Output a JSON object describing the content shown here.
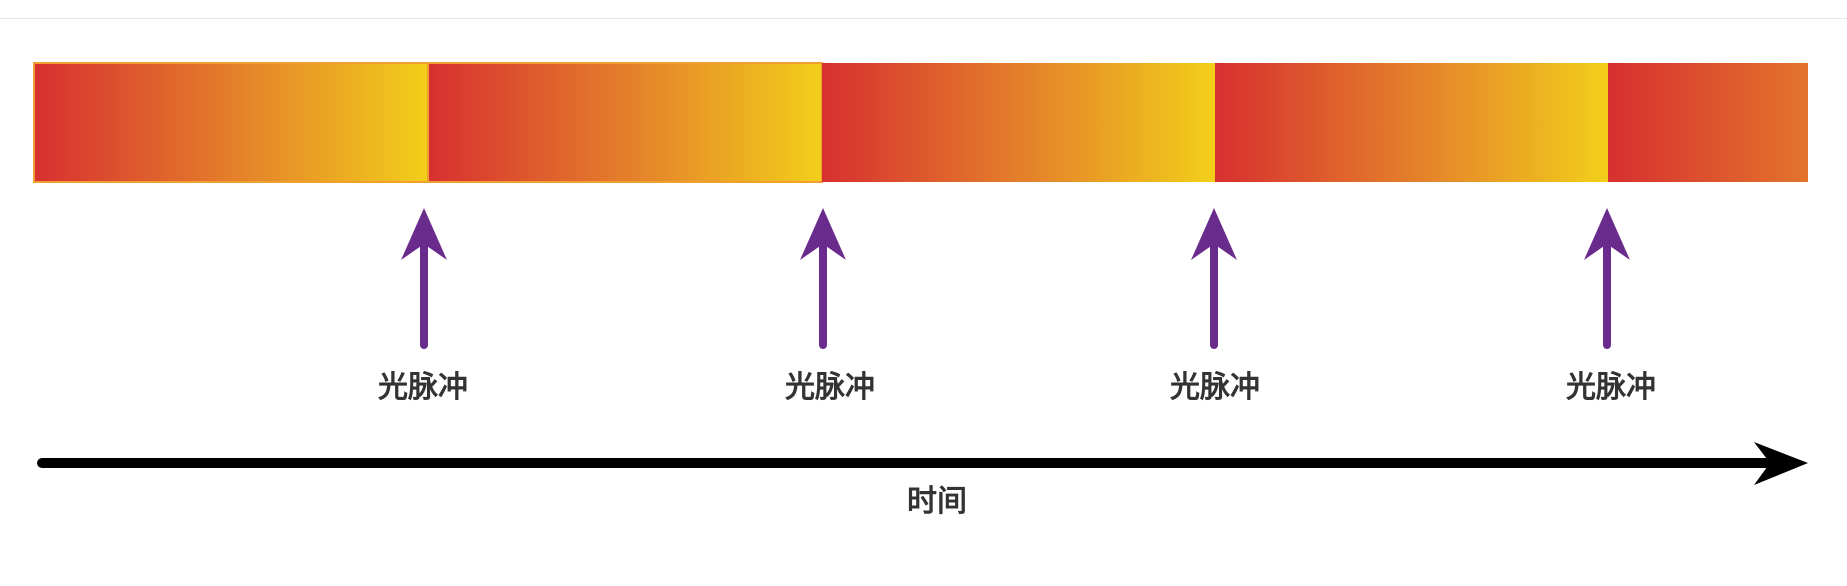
{
  "pulse_label": "光脉冲",
  "time_axis_label": "时间",
  "colors": {
    "gradient_start": "#d73030",
    "gradient_mid": "#e5862a",
    "gradient_end": "#f2cf1a",
    "segment_border": "#f0a030",
    "arrow": "#6a2c8c",
    "axis": "#000000",
    "text": "#333333"
  },
  "segments_count_visible": 5,
  "pulses": [
    {
      "label": "光脉冲"
    },
    {
      "label": "光脉冲"
    },
    {
      "label": "光脉冲"
    },
    {
      "label": "光脉冲"
    }
  ]
}
